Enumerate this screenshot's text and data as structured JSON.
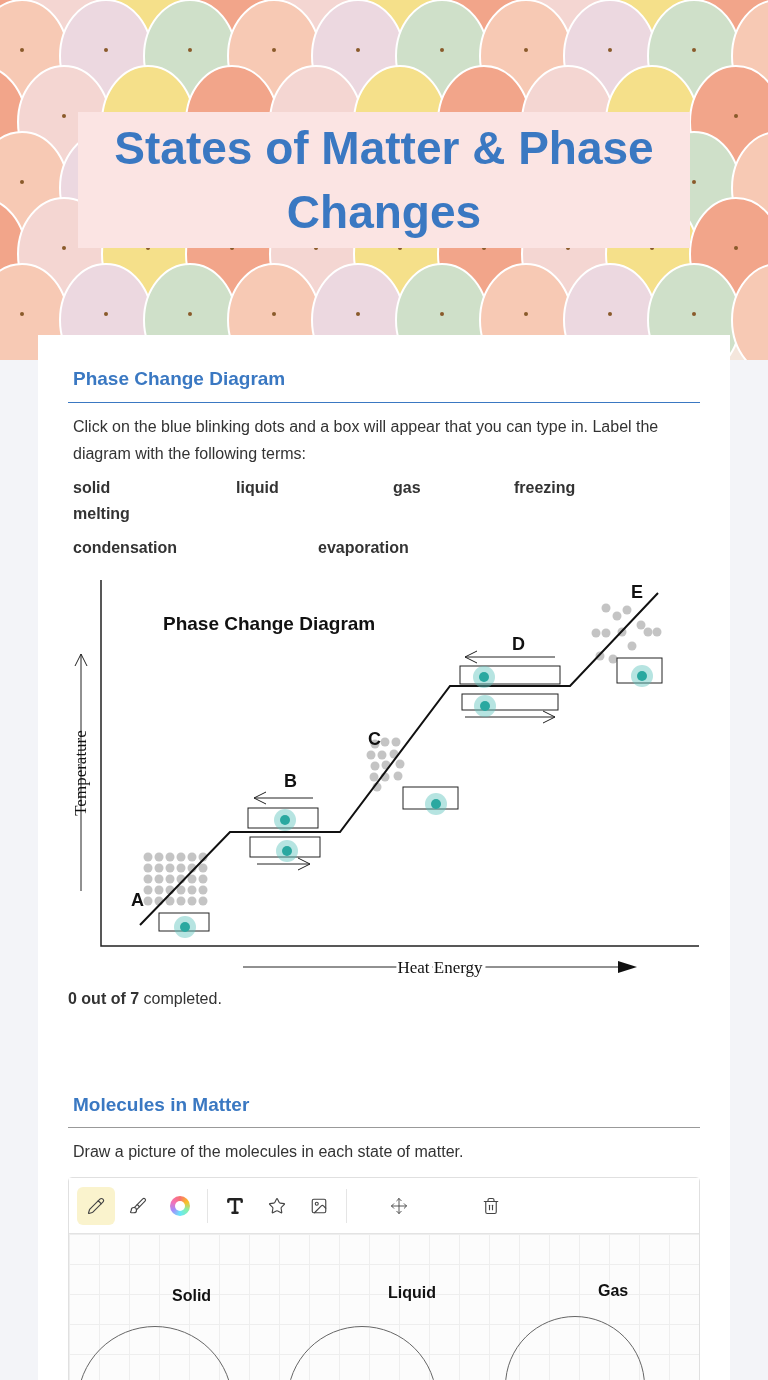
{
  "header": {
    "title": "States of Matter & Phase Changes"
  },
  "sections": [
    {
      "heading": "Phase Change Diagram",
      "accent": true,
      "instructions": "Click on the blue blinking dots and a box will appear that you can type in. Label the diagram with the following terms:",
      "term_rows": [
        [
          "solid",
          "liquid",
          "gas",
          "freezing",
          "melting"
        ],
        [
          "condensation",
          "evaporation"
        ]
      ],
      "diagram": {
        "title": "Phase Change Diagram",
        "ylabel": "Temperature",
        "xlabel": "Heat Energy",
        "points": [
          "A",
          "B",
          "C",
          "D",
          "E"
        ]
      },
      "progress": "**0 out of 7** completed."
    },
    {
      "heading": "Molecules in Matter",
      "accent": false,
      "instructions": "Draw a picture of the molecules in each state of matter.",
      "tools": [
        {
          "kind": "pencil",
          "selected": true
        },
        {
          "kind": "brush",
          "selected": false
        },
        {
          "kind": "color",
          "selected": false
        },
        {
          "kind": "divider"
        },
        {
          "kind": "text",
          "selected": false
        },
        {
          "kind": "star",
          "selected": false
        },
        {
          "kind": "image",
          "selected": false
        },
        {
          "kind": "divider"
        },
        {
          "kind": "move",
          "selected": false
        },
        {
          "kind": "trash",
          "selected": false
        }
      ],
      "canvas_labels": [
        "Solid",
        "Liquid",
        "Gas"
      ]
    }
  ]
}
